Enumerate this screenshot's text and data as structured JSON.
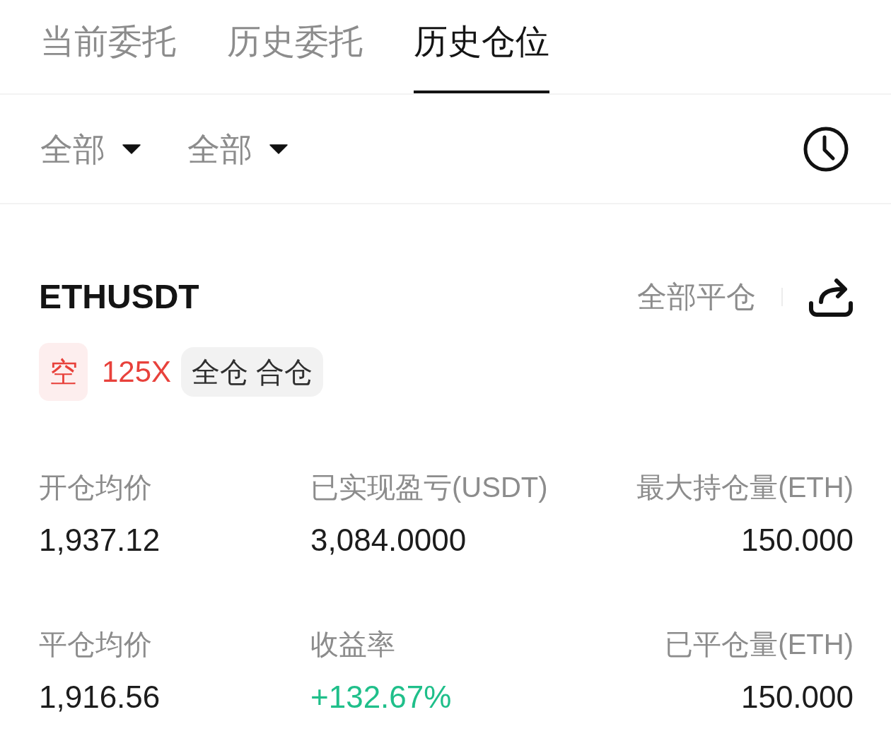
{
  "tabs": [
    {
      "label": "当前委托",
      "selected": false
    },
    {
      "label": "历史委托",
      "selected": false
    },
    {
      "label": "历史仓位",
      "selected": true
    }
  ],
  "filters": [
    {
      "label": "全部"
    },
    {
      "label": "全部"
    }
  ],
  "position": {
    "symbol": "ETHUSDT",
    "close_all": "全部平仓",
    "side": {
      "label": "空",
      "kind": "short"
    },
    "leverage": "125X",
    "margin_mode": "全仓 合仓",
    "stats": [
      {
        "label": "开仓均价",
        "value": "1,937.12",
        "kind": "plain"
      },
      {
        "label": "已实现盈亏(USDT)",
        "value": "3,084.0000",
        "kind": "plain"
      },
      {
        "label": "最大持仓量(ETH)",
        "value": "150.000",
        "kind": "plain"
      },
      {
        "label": "平仓均价",
        "value": "1,916.56",
        "kind": "plain"
      },
      {
        "label": "收益率",
        "value": "+132.67%",
        "kind": "gain"
      },
      {
        "label": "已平仓量(ETH)",
        "value": "150.000",
        "kind": "plain"
      }
    ]
  }
}
